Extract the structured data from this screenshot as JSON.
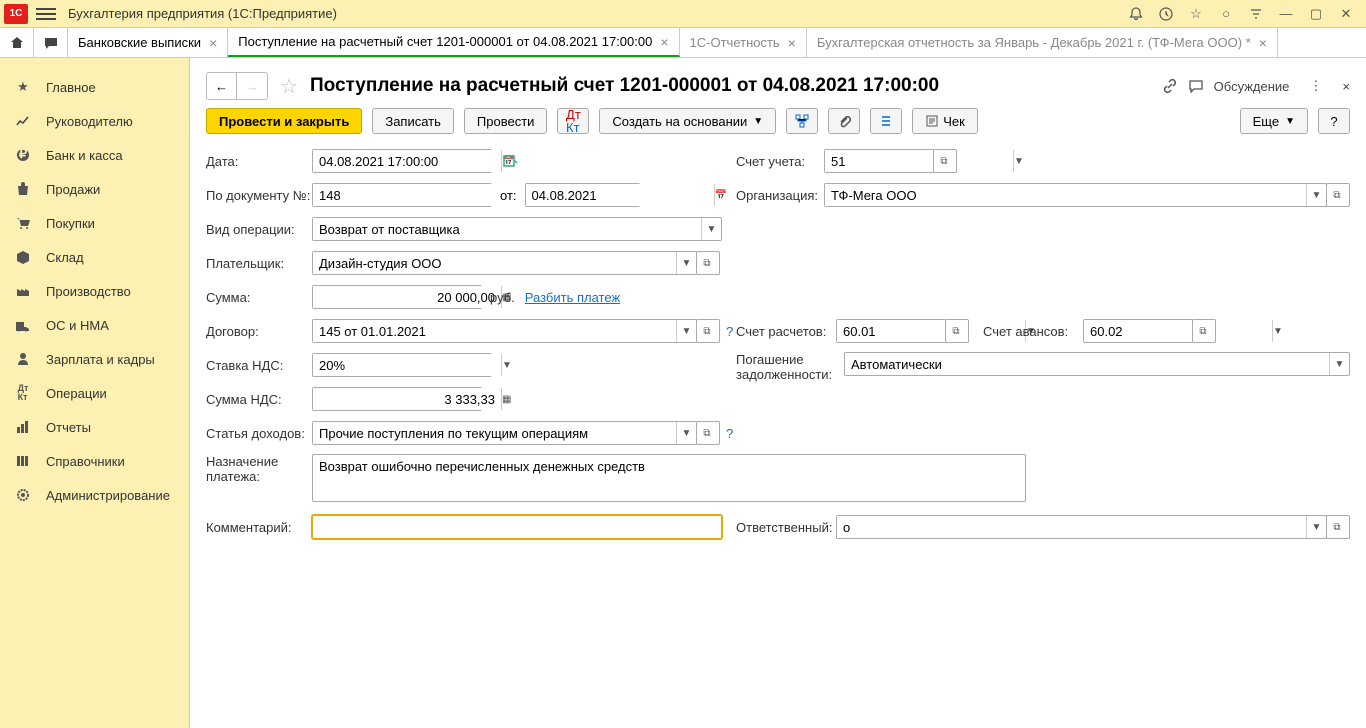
{
  "app": {
    "title": "Бухгалтерия предприятия  (1С:Предприятие)"
  },
  "tabs": {
    "t1": "Банковские выписки",
    "t2": "Поступление на расчетный счет 1201-000001 от 04.08.2021 17:00:00",
    "t3": "1С-Отчетность",
    "t4": "Бухгалтерская отчетность за Январь - Декабрь 2021 г. (ТФ-Мега ООО) *"
  },
  "nav": {
    "main": "Главное",
    "manager": "Руководителю",
    "bank": "Банк и касса",
    "sales": "Продажи",
    "purchases": "Покупки",
    "warehouse": "Склад",
    "production": "Производство",
    "os": "ОС и НМА",
    "salary": "Зарплата и кадры",
    "operations": "Операции",
    "reports": "Отчеты",
    "refs": "Справочники",
    "admin": "Администрирование"
  },
  "page": {
    "title": "Поступление на расчетный счет 1201-000001 от 04.08.2021 17:00:00",
    "discuss": "Обсуждение"
  },
  "toolbar": {
    "post_close": "Провести и закрыть",
    "write": "Записать",
    "post": "Провести",
    "create_based": "Создать на основании",
    "check": "Чек",
    "more": "Еще",
    "help": "?"
  },
  "labels": {
    "date": "Дата:",
    "doc_no": "По документу №:",
    "from": "от:",
    "op_type": "Вид операции:",
    "payer": "Плательщик:",
    "amount": "Сумма:",
    "rub": "руб.",
    "split": "Разбить платеж",
    "contract": "Договор:",
    "vat_rate": "Ставка НДС:",
    "vat_amount": "Сумма НДС:",
    "income_item": "Статья доходов:",
    "purpose": "Назначение\nплатежа:",
    "comment": "Комментарий:",
    "account": "Счет учета:",
    "org": "Организация:",
    "settle_acc": "Счет расчетов:",
    "advance_acc": "Счет авансов:",
    "debt": "Погашение задолженности:",
    "responsible": "Ответственный:"
  },
  "values": {
    "date": "04.08.2021 17:00:00",
    "doc_no": "148",
    "doc_date": "04.08.2021",
    "op_type": "Возврат от поставщика",
    "payer": "Дизайн-студия ООО",
    "amount": "20 000,00",
    "contract": "145 от 01.01.2021",
    "vat_rate": "20%",
    "vat_amount": "3 333,33",
    "income_item": "Прочие поступления по текущим операциям",
    "purpose": "Возврат ошибочно перечисленных денежных средств",
    "comment": "",
    "account": "51",
    "org": "ТФ-Мега ООО",
    "settle_acc": "60.01",
    "advance_acc": "60.02",
    "debt": "Автоматически",
    "responsible": "о"
  }
}
